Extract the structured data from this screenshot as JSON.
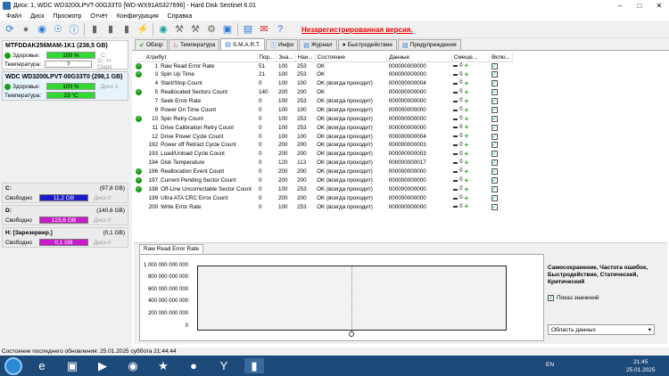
{
  "window": {
    "title": "Диск: 1, WDC WD3200LPVT-00G33T0 [WD-WX91A5327696]  -  Hard Disk Sentinel 6.01"
  },
  "menu": [
    "Файл",
    "Диск",
    "Просмотр",
    "Отчёт",
    "Конфигурация",
    "Справка"
  ],
  "unregistered": "Незарегистрированная версия.",
  "disks": [
    {
      "title": "MTFDDAK256MAM-1K1 (238,5 GB)",
      "health_label": "Здоровье:",
      "health_value": "100 %",
      "health_extra": "C:",
      "temp_label": "Температура:",
      "temp_value": "?",
      "temp_extra": "D:, H: [Заре"
    },
    {
      "title": "WDC WD3200LPVT-00G33T0 (298,1 GB)",
      "health_label": "Здоровье:",
      "health_value": "100 %",
      "health_extra": "Диск 1",
      "temp_label": "Температура:",
      "temp_value": "23 °C"
    }
  ],
  "volumes": [
    {
      "name": "C:",
      "size": "(97,8 GB)",
      "free_label": "Свободно",
      "free_value": "11,2 GB",
      "disk": "Диск 0"
    },
    {
      "name": "D:",
      "size": "(140,6 GB)",
      "free_label": "Свободно",
      "free_value": "123,6 GB",
      "disk": "Диск 0"
    },
    {
      "name": "H: [Зарезервир.]",
      "size": "(0,1 GB)",
      "free_label": "Свободно",
      "free_value": "0,1 GB",
      "disk": "Диск 0"
    }
  ],
  "tabs": [
    {
      "label": "Обзор",
      "icon": "check-icon"
    },
    {
      "label": "Температура",
      "icon": "thermometer-icon"
    },
    {
      "label": "S.M.A.R.T.",
      "icon": "smart-icon"
    },
    {
      "label": "Инфо",
      "icon": "info-icon"
    },
    {
      "label": "Журнал",
      "icon": "journal-icon"
    },
    {
      "label": "Быстродействие",
      "icon": "speed-icon"
    },
    {
      "label": "Предупреждения",
      "icon": "warning-icon"
    }
  ],
  "smart": {
    "headers": [
      "",
      "Атрибут",
      "Пор...",
      "Зна...",
      "Наи...",
      "Состояние",
      "Данные",
      "Смеще...",
      "Вклю..."
    ],
    "rows": [
      [
        "1",
        "Raw Read Error Rate",
        "51",
        "100",
        "253",
        "OK",
        "000000000000",
        "0",
        true
      ],
      [
        "3",
        "Spin Up Time",
        "21",
        "100",
        "253",
        "OK",
        "000000000000",
        "0",
        true
      ],
      [
        "4",
        "Start/Stop Count",
        "0",
        "100",
        "100",
        "OK (всегда проходит)",
        "000000000004",
        "0",
        false
      ],
      [
        "5",
        "Reallocated Sectors Count",
        "140",
        "200",
        "200",
        "OK",
        "000000000000",
        "0",
        true
      ],
      [
        "7",
        "Seek Error Rate",
        "0",
        "100",
        "253",
        "OK (всегда проходит)",
        "000000000000",
        "0",
        false
      ],
      [
        "9",
        "Power On Time Count",
        "0",
        "100",
        "100",
        "OK (всегда проходит)",
        "000000000000",
        "0",
        false
      ],
      [
        "10",
        "Spin Retry Count",
        "0",
        "100",
        "253",
        "OK (всегда проходит)",
        "000000000000",
        "0",
        true
      ],
      [
        "11",
        "Drive Calibration Retry Count",
        "0",
        "100",
        "253",
        "OK (всегда проходит)",
        "000000000000",
        "0",
        false
      ],
      [
        "12",
        "Drive Power Cycle Count",
        "0",
        "100",
        "100",
        "OK (всегда проходит)",
        "000000000004",
        "0",
        false
      ],
      [
        "192",
        "Power off Retract Cycle Count",
        "0",
        "200",
        "200",
        "OK (всегда проходит)",
        "000000000003",
        "0",
        false
      ],
      [
        "193",
        "Load/Unload Cycle Count",
        "0",
        "200",
        "200",
        "OK (всегда проходит)",
        "000000000003",
        "0",
        false
      ],
      [
        "194",
        "Disk Temperature",
        "0",
        "120",
        "113",
        "OK (всегда проходит)",
        "000000000017",
        "0",
        false
      ],
      [
        "196",
        "Reallocation Event Count",
        "0",
        "200",
        "200",
        "OK (всегда проходит)",
        "000000000000",
        "0",
        true
      ],
      [
        "197",
        "Current Pending Sector Count",
        "0",
        "200",
        "200",
        "OK (всегда проходит)",
        "000000000000",
        "0",
        true
      ],
      [
        "198",
        "Off-Line Uncorrectable Sector Count",
        "0",
        "100",
        "253",
        "OK (всегда проходит)",
        "000000000000",
        "0",
        true
      ],
      [
        "199",
        "Ultra ATA CRC Error Count",
        "0",
        "200",
        "200",
        "OK (всегда проходит)",
        "000000000000",
        "0",
        false
      ],
      [
        "200",
        "Write Error Rate",
        "0",
        "100",
        "253",
        "OK (всегда проходит)",
        "000000000000",
        "0",
        false
      ]
    ]
  },
  "graph": {
    "tab": "Raw Read Error Rate",
    "yticks": [
      "1 000 000 000 000",
      "800 000 000 000",
      "600 000 000 000",
      "400 000 000 000",
      "200 000 000 000",
      "0"
    ],
    "side_text": "Самосохранение, Частота ошибок, Быстродействие, Статический, Критический",
    "show_values": "Показ значений",
    "area_select": "Область данных"
  },
  "status": "Состояние последнего обновления: 25.01.2025 суббота 21:44:44",
  "taskbar": {
    "lang": "EN",
    "time": "21:45",
    "date": "25.01.2025"
  }
}
